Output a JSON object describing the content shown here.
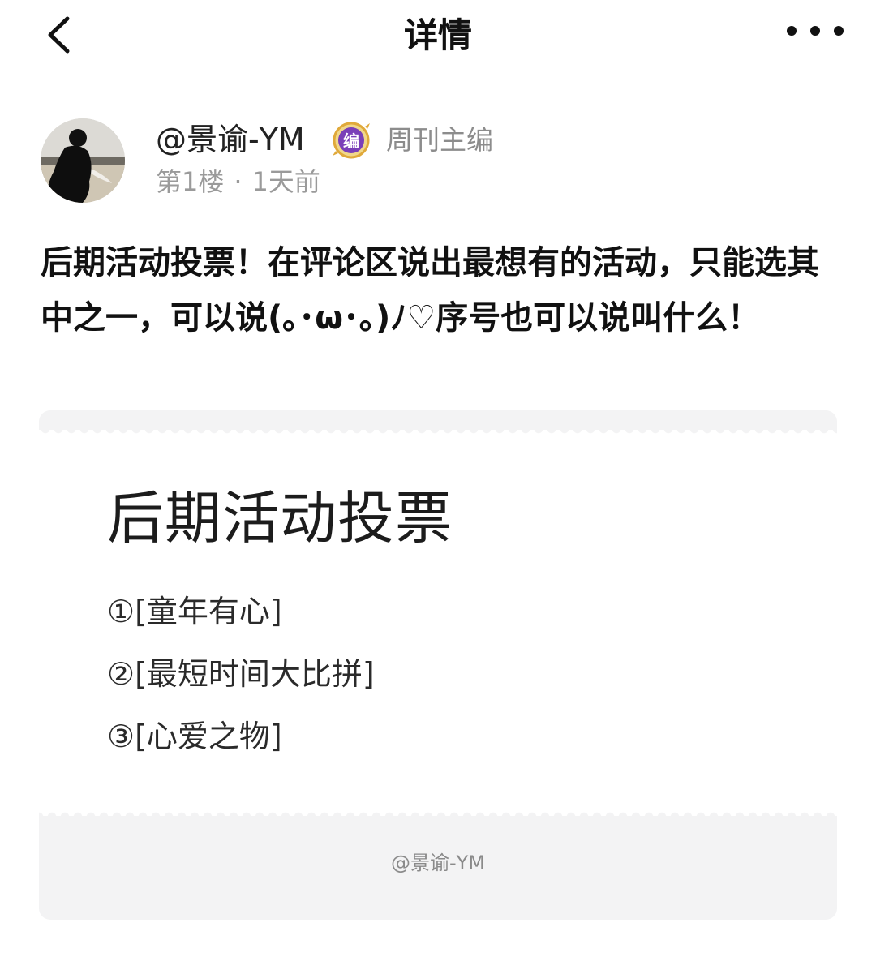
{
  "nav": {
    "back_icon": "chevron-left-icon",
    "title": "详情",
    "more_icon": "more-horizontal-icon"
  },
  "author": {
    "avatar_icon": "avatar",
    "name": "@景谕-YM",
    "badge_icon": "editor-badge-icon",
    "badge_glyph": "编",
    "badge_label": "周刊主编",
    "floor": "第1楼",
    "separator": "·",
    "time": "1天前"
  },
  "post": {
    "text": "后期活动投票！在评论区说出最想有的活动，只能选其中之一，可以说(｡･ω･｡)ﾉ♡序号也可以说叫什么！"
  },
  "card": {
    "title": "后期活动投票",
    "items": [
      "①[童年有心]",
      "②[最短时间大比拼]",
      "③[心爱之物]"
    ],
    "footer": "@景谕-YM"
  },
  "colors": {
    "text": "#111111",
    "muted": "#9a9a9a",
    "badge_purple": "#7a3fb8",
    "badge_gold": "#e0a93a",
    "card_bg": "#f3f3f4"
  }
}
